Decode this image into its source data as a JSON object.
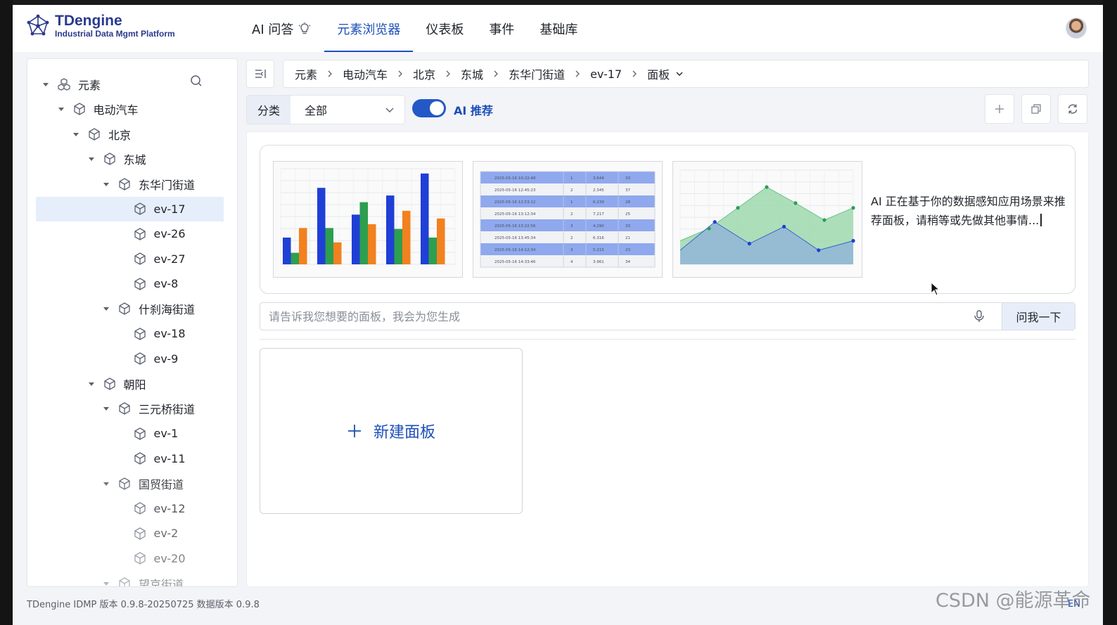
{
  "app": {
    "logo_title": "TDengine",
    "logo_subtitle": "Industrial Data Mgmt Platform",
    "brand_color": "#1d4fb8"
  },
  "nav": {
    "items": [
      {
        "label": "AI 问答",
        "icon": "lightbulb-icon",
        "active": false
      },
      {
        "label": "元素浏览器",
        "active": true
      },
      {
        "label": "仪表板",
        "active": false
      },
      {
        "label": "事件",
        "active": false
      },
      {
        "label": "基础库",
        "active": false
      }
    ]
  },
  "sidebar": {
    "tree": [
      {
        "label": "元素",
        "level": 0,
        "expanded": true,
        "icon": "elements-icon"
      },
      {
        "label": "电动汽车",
        "level": 1,
        "expanded": true,
        "icon": "cube-icon"
      },
      {
        "label": "北京",
        "level": 2,
        "expanded": true,
        "icon": "cube-icon"
      },
      {
        "label": "东城",
        "level": 3,
        "expanded": true,
        "icon": "cube-icon"
      },
      {
        "label": "东华门街道",
        "level": 4,
        "expanded": true,
        "icon": "cube-icon"
      },
      {
        "label": "ev-17",
        "level": 5,
        "selected": true,
        "icon": "cube-icon"
      },
      {
        "label": "ev-26",
        "level": 5,
        "icon": "cube-icon"
      },
      {
        "label": "ev-27",
        "level": 5,
        "icon": "cube-icon"
      },
      {
        "label": "ev-8",
        "level": 5,
        "icon": "cube-icon"
      },
      {
        "label": "什刹海街道",
        "level": 4,
        "expanded": true,
        "icon": "cube-icon"
      },
      {
        "label": "ev-18",
        "level": 5,
        "icon": "cube-icon"
      },
      {
        "label": "ev-9",
        "level": 5,
        "icon": "cube-icon"
      },
      {
        "label": "朝阳",
        "level": 3,
        "expanded": true,
        "icon": "cube-icon"
      },
      {
        "label": "三元桥街道",
        "level": 4,
        "expanded": true,
        "icon": "cube-icon"
      },
      {
        "label": "ev-1",
        "level": 5,
        "icon": "cube-icon"
      },
      {
        "label": "ev-11",
        "level": 5,
        "icon": "cube-icon"
      },
      {
        "label": "国贸街道",
        "level": 4,
        "expanded": true,
        "icon": "cube-icon"
      },
      {
        "label": "ev-12",
        "level": 5,
        "icon": "cube-icon"
      },
      {
        "label": "ev-2",
        "level": 5,
        "icon": "cube-icon"
      },
      {
        "label": "ev-20",
        "level": 5,
        "icon": "cube-icon"
      },
      {
        "label": "望京街道",
        "level": 4,
        "expanded": true,
        "icon": "cube-icon"
      }
    ]
  },
  "breadcrumb": {
    "items": [
      "元素",
      "电动汽车",
      "北京",
      "东城",
      "东华门街道",
      "ev-17",
      "面板"
    ]
  },
  "filter": {
    "label": "分类",
    "value": "全部"
  },
  "ai_toggle": {
    "label": "AI 推荐",
    "on": true
  },
  "preview": {
    "ai_message": "AI 正在基于你的数据感知应用场景来推荐面板，请稍等或先做其他事情...",
    "bar_groups": [
      [
        0.28,
        0.12,
        0.38
      ],
      [
        0.8,
        0.38,
        0.23
      ],
      [
        0.52,
        0.65,
        0.42
      ],
      [
        0.72,
        0.37,
        0.56
      ],
      [
        0.95,
        0.28,
        0.48
      ]
    ],
    "bar_colors": [
      "#1f3fd6",
      "#2e9e4f",
      "#f2811f"
    ],
    "table_rows": [
      [
        "2025-05-16 10:22:48",
        "1",
        "3.644",
        "33"
      ],
      [
        "2025-05-16 12:45:23",
        "2",
        "2.345",
        "37"
      ],
      [
        "2025-05-16 12:53:12",
        "1",
        "6.239",
        "28"
      ],
      [
        "2025-05-16 13:12:34",
        "2",
        "7.217",
        "25"
      ],
      [
        "2025-05-16 13:22:56",
        "3",
        "4.290",
        "33"
      ],
      [
        "2025-05-16 13:45:34",
        "2",
        "6.316",
        "21"
      ],
      [
        "2025-05-16 14:12:34",
        "3",
        "5.215",
        "23"
      ],
      [
        "2025-05-16 14:33:46",
        "4",
        "3.961",
        "34"
      ]
    ],
    "area_series_green": [
      0.25,
      0.38,
      0.6,
      0.82,
      0.65,
      0.47,
      0.6
    ],
    "area_series_blue": [
      0.15,
      0.45,
      0.22,
      0.4,
      0.15,
      0.25
    ]
  },
  "ask": {
    "placeholder": "请告诉我您想要的面板，我会为您生成",
    "button_label": "问我一下"
  },
  "new_panel": {
    "label": "新建面板"
  },
  "footer": {
    "version": "TDengine IDMP 版本 0.9.8-20250725 数据版本 0.9.8",
    "lang": "EN"
  },
  "watermark": "CSDN @能源革命"
}
